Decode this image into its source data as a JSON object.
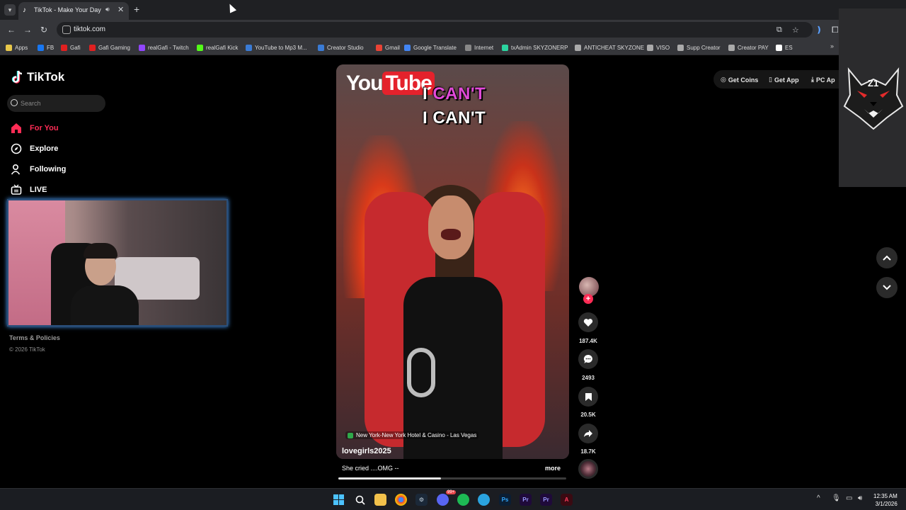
{
  "browser": {
    "tab_title": "TikTok - Make Your Day",
    "url": "tiktok.com"
  },
  "bookmarks": [
    {
      "label": "Apps",
      "color": "#e8c84a"
    },
    {
      "label": "FB",
      "color": "#1877f2"
    },
    {
      "label": "Gafi",
      "color": "#e02020"
    },
    {
      "label": "Gafi Gaming",
      "color": "#e02020"
    },
    {
      "label": "realGafi - Twitch",
      "color": "#9146ff"
    },
    {
      "label": "realGafi Kick",
      "color": "#53fc18"
    },
    {
      "label": "YouTube to Mp3 M...",
      "color": "#3a7bd5"
    },
    {
      "label": "Creator Studio",
      "color": "#3a7bd5"
    },
    {
      "label": "Gmail",
      "color": "#ea4335"
    },
    {
      "label": "Google Translate",
      "color": "#4285f4"
    },
    {
      "label": "Internet",
      "color": "#888888"
    },
    {
      "label": "txAdmin SKYZONERP",
      "color": "#2bd4a0"
    },
    {
      "label": "ANTICHEAT SKYZONE",
      "color": "#aaaaaa"
    },
    {
      "label": "VISO",
      "color": "#aaaaaa"
    },
    {
      "label": "Supp Creator",
      "color": "#aaaaaa"
    },
    {
      "label": "Creator PAY",
      "color": "#aaaaaa"
    },
    {
      "label": "ES",
      "color": "#ffffff"
    }
  ],
  "tiktok": {
    "logo_text": "TikTok",
    "search_placeholder": "Search",
    "nav": [
      {
        "label": "For You",
        "icon": "home-icon",
        "active": true
      },
      {
        "label": "Explore",
        "icon": "compass-icon",
        "active": false
      },
      {
        "label": "Following",
        "icon": "user-icon",
        "active": false
      },
      {
        "label": "LIVE",
        "icon": "live-icon",
        "active": false
      }
    ],
    "footer": {
      "terms": "Terms & Policies",
      "copyright": "© 2026 TikTok"
    },
    "header_buttons": {
      "coins": "Get Coins",
      "app": "Get App",
      "pc": "PC Ap"
    }
  },
  "video": {
    "overlay_brand_you": "You",
    "overlay_brand_tube": "Tube",
    "caption_line1_white": "I ",
    "caption_line1_pink": "CAN'T",
    "caption_line2": "I CAN'T",
    "location": "New York-New York Hotel & Casino - Las Vegas",
    "username": "lovegirls2025",
    "description": "She cried ....OMG --",
    "more_label": "more",
    "progress": 0.45,
    "likes": "187.4K",
    "comments": "2493",
    "saves": "20.5K",
    "shares": "18.7K",
    "follow_symbol": "+"
  },
  "overlay_logo": {
    "tag": "Z1"
  },
  "taskbar": {
    "time": "12:35 AM",
    "date": "3/1/2026",
    "discord_badge": "99+",
    "ps_label": "Ps",
    "pr1_label": "Pr",
    "pr2_label": "Pr"
  }
}
